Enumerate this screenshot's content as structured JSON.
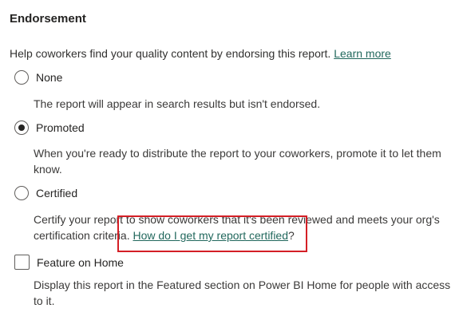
{
  "section": {
    "title": "Endorsement",
    "intro_text": "Help coworkers find your quality content by endorsing this report. ",
    "learn_more": "Learn more"
  },
  "options": {
    "none": {
      "label": "None",
      "description": "The report will appear in search results but isn't endorsed.",
      "selected": false
    },
    "promoted": {
      "label": "Promoted",
      "description": "When you're ready to distribute the report to your coworkers, promote it to let them know.",
      "selected": true
    },
    "certified": {
      "label": "Certified",
      "description": "Certify your report to show coworkers that it's been reviewed and meets your org's certification criteria. ",
      "help_link": "How do I get my report certified",
      "help_suffix": "?",
      "selected": false
    }
  },
  "feature_on_home": {
    "label": "Feature on Home",
    "description": "Display this report in the Featured section on Power BI Home for people with access to it.",
    "checked": false
  },
  "colors": {
    "link": "#22685d",
    "highlight": "#d41f26"
  }
}
